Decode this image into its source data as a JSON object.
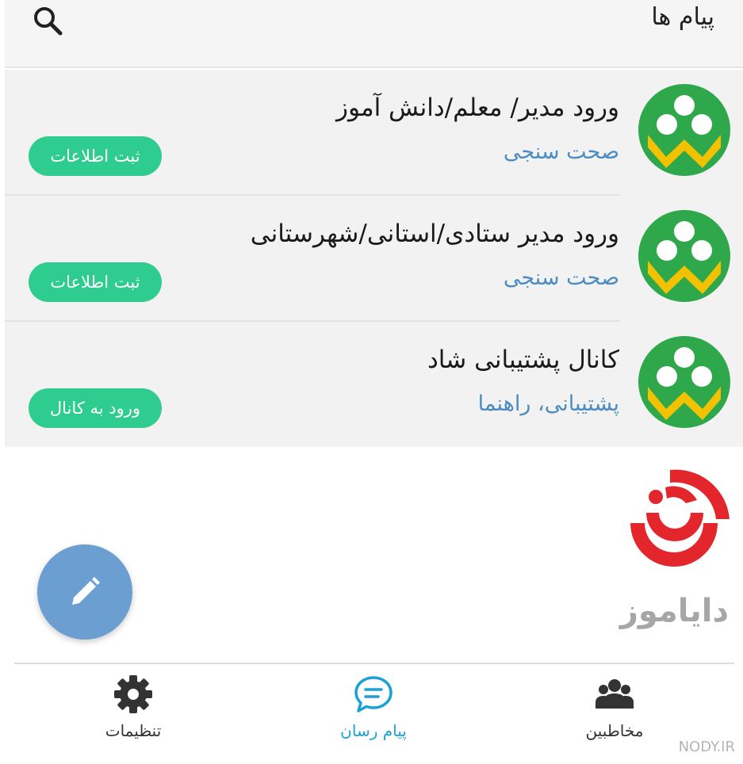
{
  "header": {
    "title": "پیام ها",
    "search_icon": "search-icon"
  },
  "chats": [
    {
      "title": "ورود مدیر/ معلم/دانش آموز",
      "subtitle": "صحت سنجی",
      "action": "ثبت اطلاعات",
      "avatar_icon": "shad-logo-icon"
    },
    {
      "title": "ورود مدیر ستادی/استانی/شهرستانی",
      "subtitle": "صحت سنجی",
      "action": "ثبت اطلاعات",
      "avatar_icon": "shad-logo-icon"
    },
    {
      "title": "کانال پشتیبانی شاد",
      "subtitle": "پشتیبانی، راهنما",
      "action": "ورود به کانال",
      "avatar_icon": "shad-logo-icon"
    }
  ],
  "brand": {
    "name": "دایاموز",
    "logo_icon": "dayamooz-logo-icon"
  },
  "fab": {
    "icon": "pencil-icon"
  },
  "bottom_nav": {
    "settings": {
      "label": "تنظیمات",
      "icon": "gear-icon"
    },
    "messenger": {
      "label": "پیام رسان",
      "icon": "chat-bubble-icon",
      "active": true
    },
    "contacts": {
      "label": "مخاطبین",
      "icon": "people-icon"
    }
  },
  "watermark": "NODY.IR",
  "colors": {
    "badge": "#2ecc8f",
    "subtitle": "#4c8cc2",
    "active_nav": "#1ba1d6",
    "inactive_nav": "#333333",
    "fab": "#6b9fd2",
    "avatar_green": "#2ea84a",
    "avatar_yellow": "#f2c200",
    "brand_red": "#e2262c"
  }
}
